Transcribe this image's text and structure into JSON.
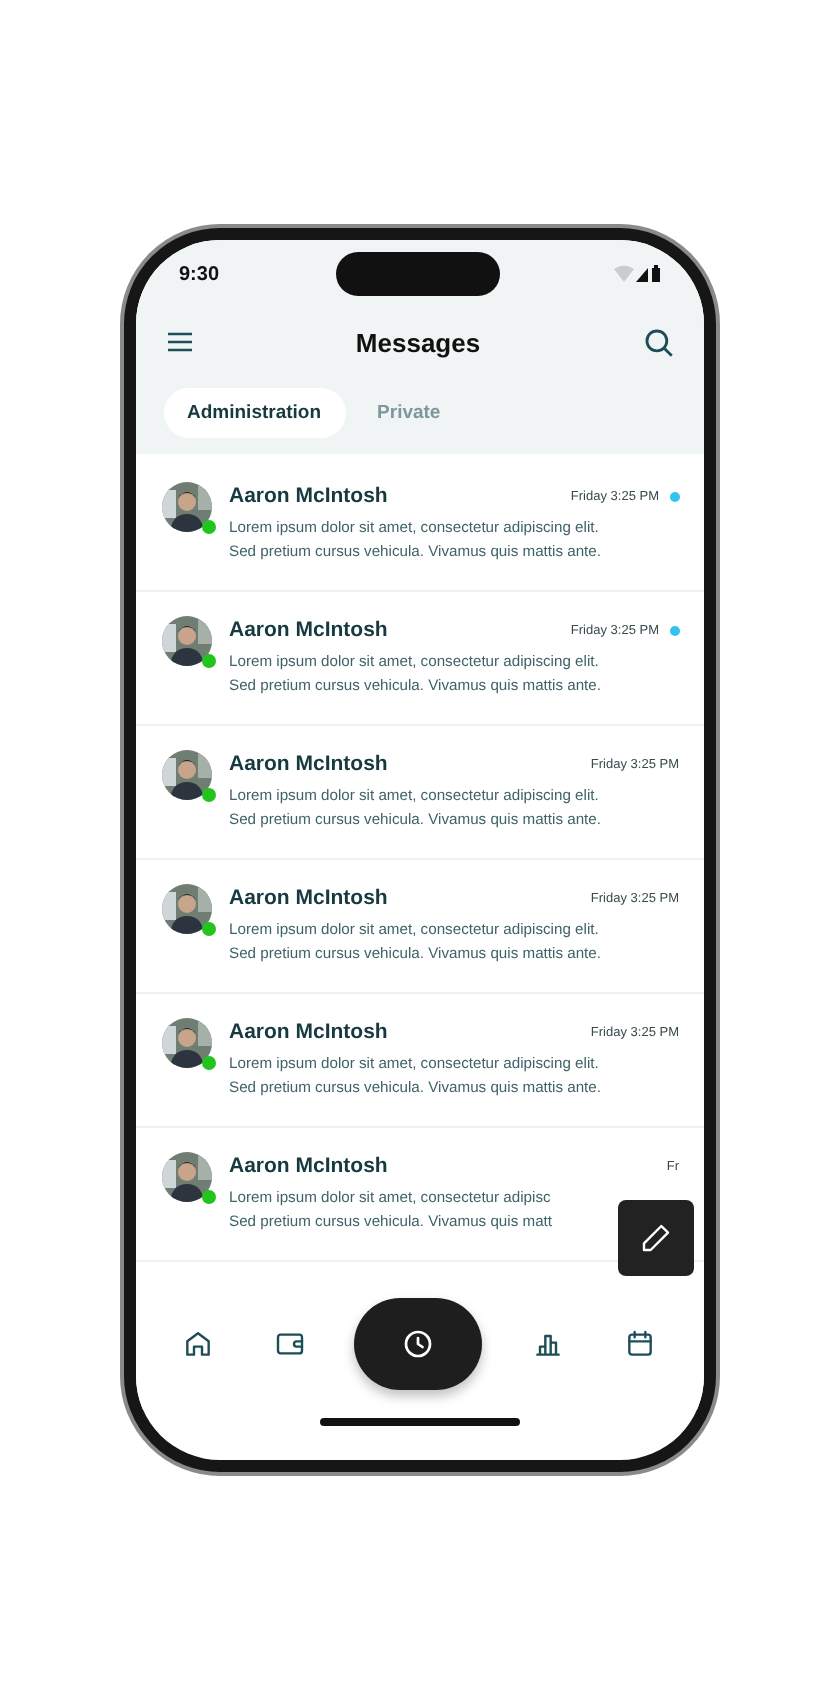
{
  "status_bar": {
    "time": "9:30"
  },
  "header": {
    "title": "Messages"
  },
  "tabs": [
    {
      "label": "Administration",
      "selected": true
    },
    {
      "label": "Private",
      "selected": false
    }
  ],
  "messages": [
    {
      "name": "Aaron McIntosh",
      "time": "Friday 3:25 PM",
      "unread": true,
      "online": true,
      "lines": [
        "Lorem ipsum dolor sit amet, consectetur adipiscing elit.",
        "Sed pretium cursus vehicula. Vivamus quis mattis ante."
      ]
    },
    {
      "name": "Aaron McIntosh",
      "time": "Friday 3:25 PM",
      "unread": true,
      "online": true,
      "lines": [
        "Lorem ipsum dolor sit amet, consectetur adipiscing elit.",
        "Sed pretium cursus vehicula. Vivamus quis mattis ante."
      ]
    },
    {
      "name": "Aaron McIntosh",
      "time": "Friday 3:25 PM",
      "unread": false,
      "online": true,
      "lines": [
        "Lorem ipsum dolor sit amet, consectetur adipiscing elit.",
        "Sed pretium cursus vehicula. Vivamus quis mattis ante."
      ]
    },
    {
      "name": "Aaron McIntosh",
      "time": "Friday 3:25 PM",
      "unread": false,
      "online": true,
      "lines": [
        "Lorem ipsum dolor sit amet, consectetur adipiscing elit.",
        "Sed pretium cursus vehicula. Vivamus quis mattis ante."
      ]
    },
    {
      "name": "Aaron McIntosh",
      "time": "Friday 3:25 PM",
      "unread": false,
      "online": true,
      "lines": [
        "Lorem ipsum dolor sit amet, consectetur adipiscing elit.",
        "Sed pretium cursus vehicula. Vivamus quis mattis ante."
      ]
    },
    {
      "name": "Aaron McIntosh",
      "time": "Fr",
      "unread": false,
      "online": true,
      "lines": [
        "Lorem ipsum dolor sit amet, consectetur adipisc",
        "Sed pretium cursus vehicula. Vivamus quis matt"
      ]
    }
  ],
  "nav": [
    {
      "kind": "home",
      "selected": false
    },
    {
      "kind": "wallet",
      "selected": false
    },
    {
      "kind": "clock",
      "selected": true
    },
    {
      "kind": "chart",
      "selected": false
    },
    {
      "kind": "calendar",
      "selected": false
    }
  ]
}
